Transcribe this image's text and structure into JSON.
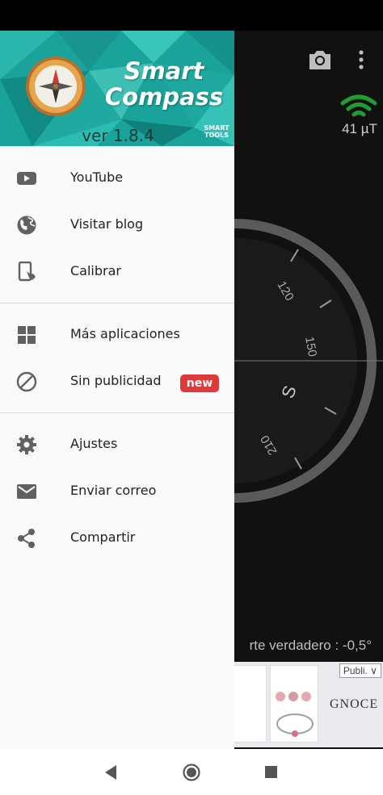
{
  "background": {
    "field_strength": "41 µT",
    "dial_ticks": [
      "120",
      "150",
      "S",
      "210"
    ],
    "declination_text": "rte verdadero : -0,5°",
    "ad_badge": "Publi. ∨",
    "ad_brand": "GNOCE"
  },
  "drawer": {
    "header": {
      "title_line1": "Smart",
      "title_line2": "Compass",
      "version": "ver 1.8.4",
      "publisher_line1": "SMART",
      "publisher_line2": "TOOLS",
      "colors": {
        "teal": "#1aa39b",
        "teal_light": "#4fd0c2",
        "teal_dark": "#0f7f79"
      }
    },
    "items": [
      {
        "label": "YouTube",
        "icon": "youtube-icon"
      },
      {
        "label": "Visitar blog",
        "icon": "globe-icon"
      },
      {
        "label": "Calibrar",
        "icon": "calibrate-phone-icon"
      },
      {
        "label": "Más aplicaciones",
        "icon": "apps-grid-icon"
      },
      {
        "label": "Sin publicidad",
        "icon": "no-ads-icon",
        "badge": "new"
      },
      {
        "label": "Ajustes",
        "icon": "gear-icon"
      },
      {
        "label": "Enviar correo",
        "icon": "mail-icon"
      },
      {
        "label": "Compartir",
        "icon": "share-icon"
      }
    ],
    "badge_color": "#e03939"
  },
  "nav": {
    "icons": [
      "back-icon",
      "home-icon",
      "recents-icon"
    ]
  }
}
